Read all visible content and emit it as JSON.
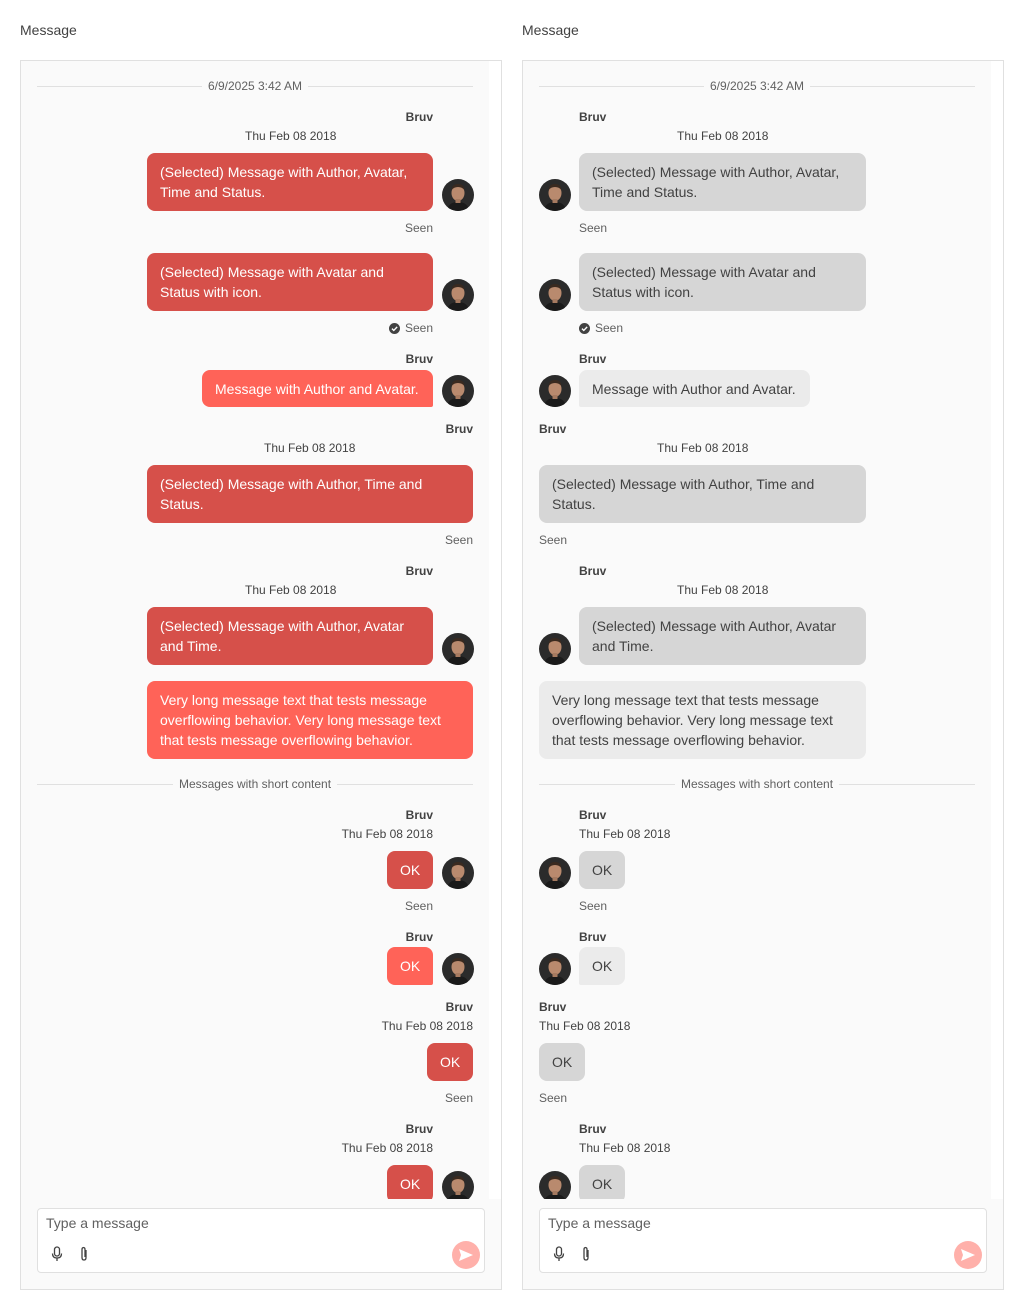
{
  "panels": [
    {
      "title": "Message",
      "date_separator": "6/9/2025 3:42 AM",
      "short_separator": "Messages with short content",
      "input_placeholder": "Type a message",
      "messages": {
        "m1": {
          "author": "Bruv",
          "time": "Thu Feb 08 2018",
          "text": "(Selected) Message with Author, Avatar, Time and Status.",
          "status": "Seen"
        },
        "m2": {
          "text": "(Selected) Message with Avatar and Status with icon.",
          "status": "Seen"
        },
        "m3": {
          "author": "Bruv",
          "text": "Message with Author and Avatar."
        },
        "m4": {
          "author": "Bruv",
          "time": "Thu Feb 08 2018",
          "text": "(Selected) Message with Author, Time and Status.",
          "status": "Seen"
        },
        "m5": {
          "author": "Bruv",
          "time": "Thu Feb 08 2018",
          "text": "(Selected) Message with Author, Avatar and Time."
        },
        "m6": {
          "text": "Very long message text that tests message overflowing behavior. Very long message text that tests message overflowing behavior."
        },
        "s1": {
          "author": "Bruv",
          "time": "Thu Feb 08 2018",
          "text": "OK",
          "status": "Seen"
        },
        "s2": {
          "author": "Bruv",
          "text": "OK"
        },
        "s3": {
          "author": "Bruv",
          "time": "Thu Feb 08 2018",
          "text": "OK",
          "status": "Seen"
        },
        "s4": {
          "author": "Bruv",
          "time": "Thu Feb 08 2018",
          "text": "OK"
        }
      }
    },
    {
      "title": "Message",
      "date_separator": "6/9/2025 3:42 AM",
      "short_separator": "Messages with short content",
      "input_placeholder": "Type a message",
      "messages": {
        "m1": {
          "author": "Bruv",
          "time": "Thu Feb 08 2018",
          "text": "(Selected) Message with Author, Avatar, Time and Status.",
          "status": "Seen"
        },
        "m2": {
          "text": "(Selected) Message with Avatar and Status with icon.",
          "status": "Seen"
        },
        "m3": {
          "author": "Bruv",
          "text": "Message with Author and Avatar."
        },
        "m4": {
          "author": "Bruv",
          "time": "Thu Feb 08 2018",
          "text": "(Selected) Message with Author, Time and Status.",
          "status": "Seen"
        },
        "m5": {
          "author": "Bruv",
          "time": "Thu Feb 08 2018",
          "text": "(Selected) Message with Author, Avatar and Time."
        },
        "m6": {
          "text": "Very long message text that tests message overflowing behavior. Very long message text that tests message overflowing behavior."
        },
        "s1": {
          "author": "Bruv",
          "time": "Thu Feb 08 2018",
          "text": "OK",
          "status": "Seen"
        },
        "s2": {
          "author": "Bruv",
          "text": "OK"
        },
        "s3": {
          "author": "Bruv",
          "time": "Thu Feb 08 2018",
          "text": "OK",
          "status": "Seen"
        },
        "s4": {
          "author": "Bruv",
          "time": "Thu Feb 08 2018",
          "text": "OK"
        }
      }
    }
  ],
  "icons": {
    "avatar": "user-avatar",
    "status": "check-circle-icon",
    "mic": "microphone-icon",
    "attach": "paperclip-icon",
    "send": "send-icon"
  },
  "colors": {
    "accent": "#ff6358",
    "accent_selected": "#d6504a",
    "incoming": "#ebebeb",
    "incoming_selected": "#d6d6d6",
    "send_disabled": "#ffb0aa"
  }
}
